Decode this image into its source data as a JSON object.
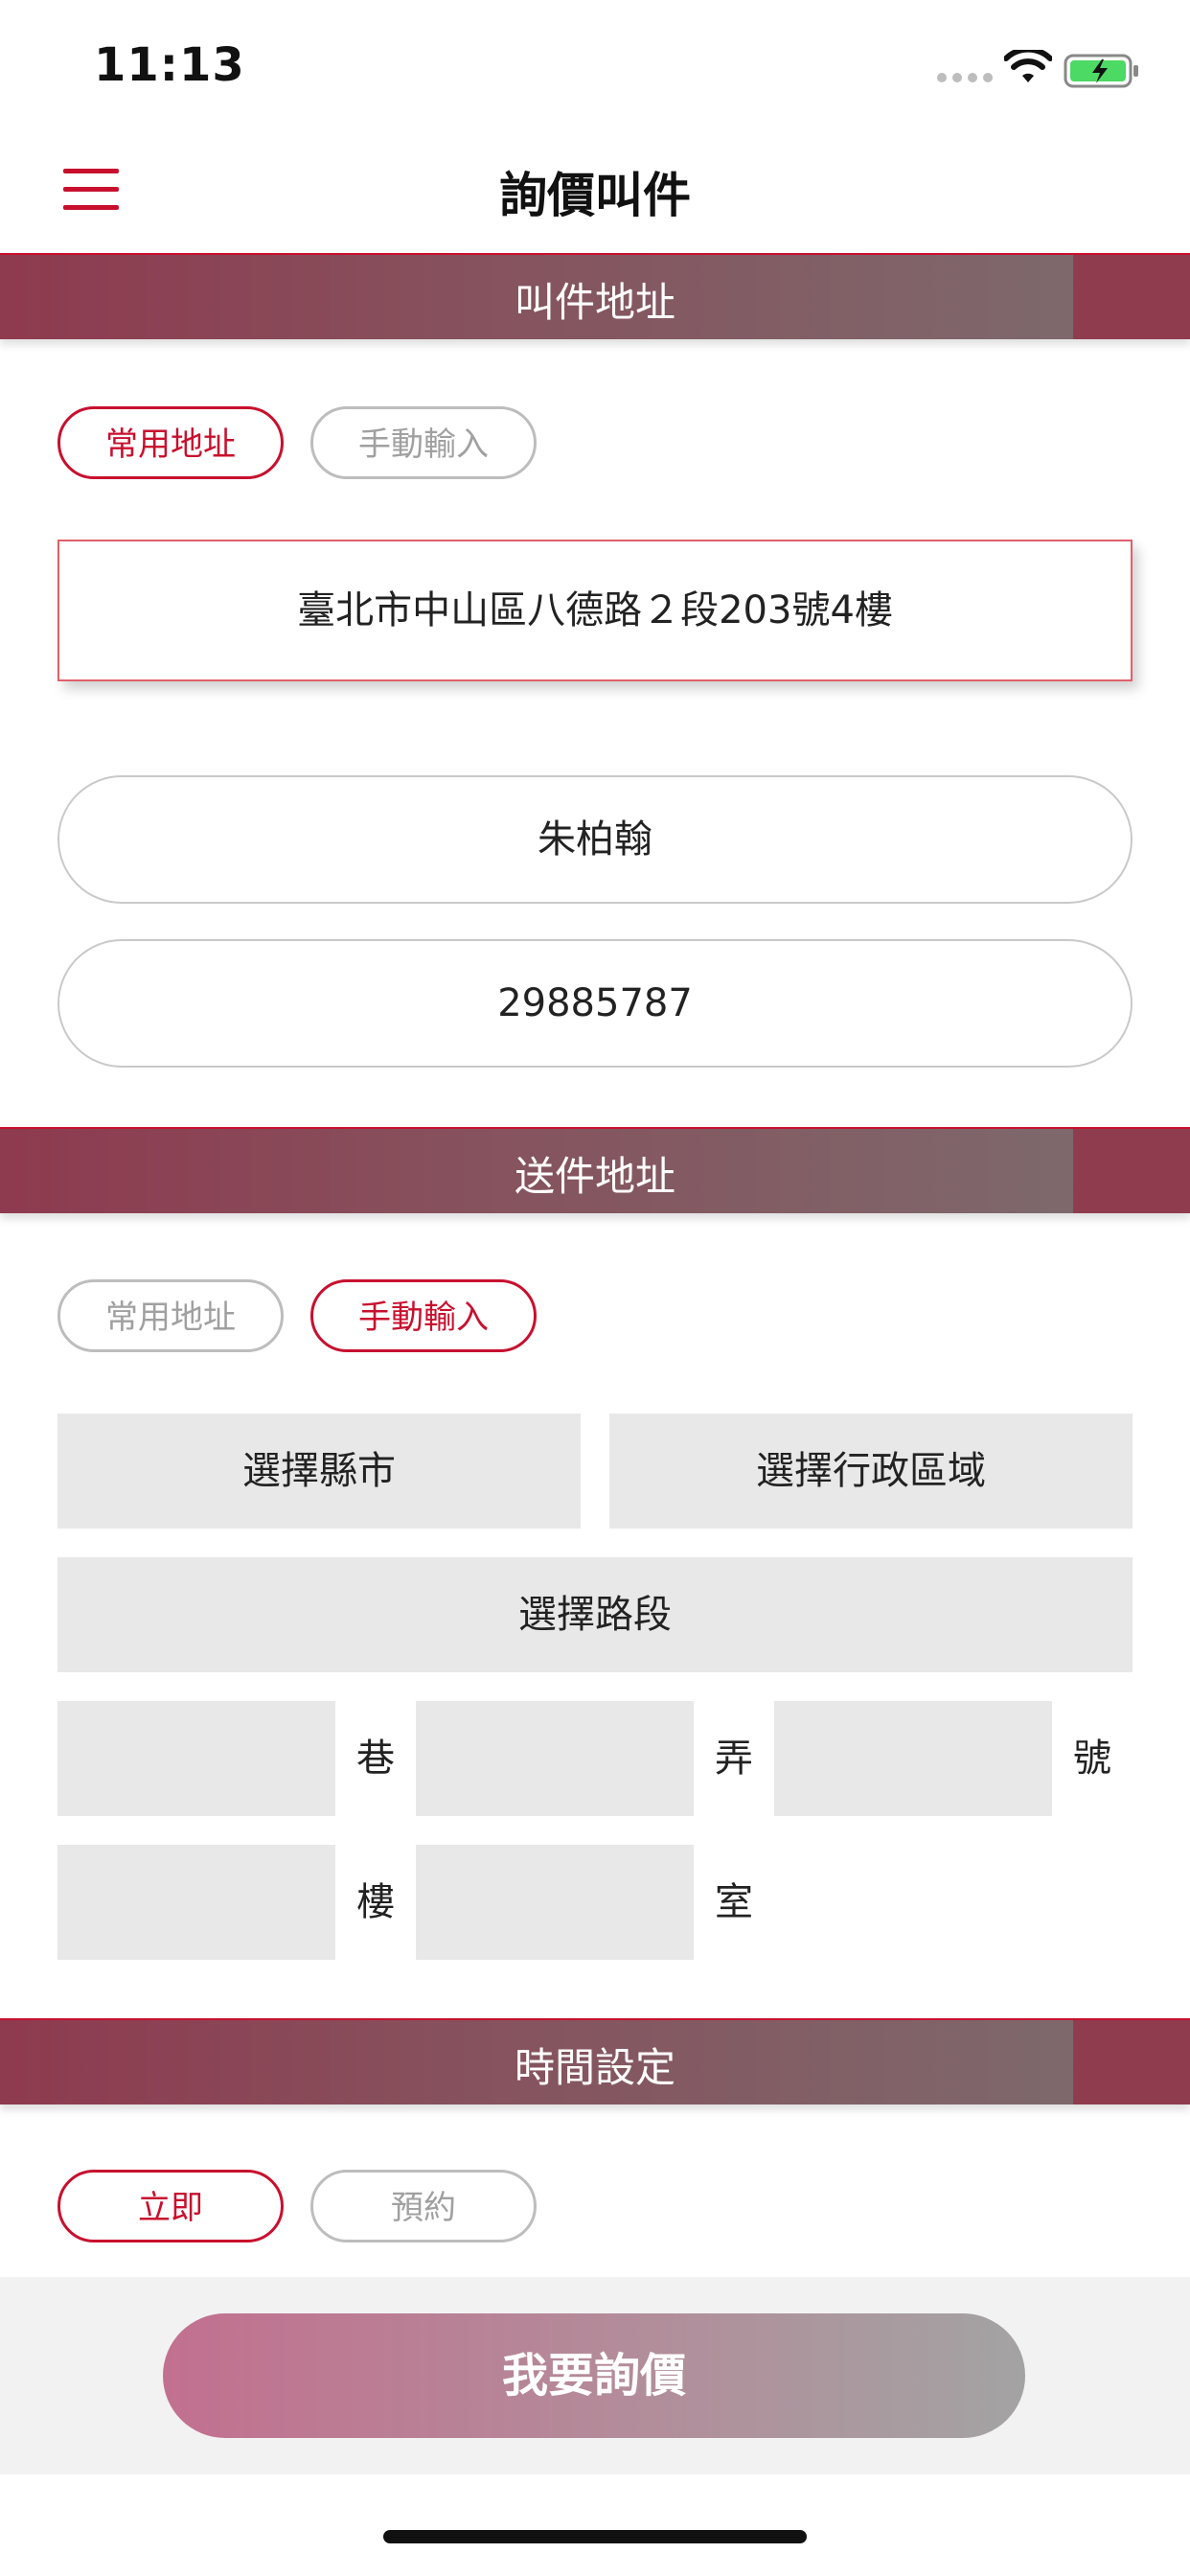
{
  "status": {
    "time": "11:13"
  },
  "header": {
    "title": "詢價叫件"
  },
  "pickup": {
    "section_title": "叫件地址",
    "tabs": [
      {
        "label": "常用地址",
        "active": true
      },
      {
        "label": "手動輸入",
        "active": false
      }
    ],
    "selected_address": "臺北市中山區八德路２段203號4樓",
    "name": "朱柏翰",
    "phone": "29885787"
  },
  "delivery": {
    "section_title": "送件地址",
    "tabs": [
      {
        "label": "常用地址",
        "active": false
      },
      {
        "label": "手動輸入",
        "active": true
      }
    ],
    "city_select": "選擇縣市",
    "district_select": "選擇行政區域",
    "road_select": "選擇路段",
    "lane_input": "",
    "lane_suffix": "巷",
    "alley_input": "",
    "alley_suffix": "弄",
    "number_input": "",
    "number_suffix": "號",
    "floor_input": "",
    "floor_suffix": "樓",
    "room_input": "",
    "room_suffix": "室"
  },
  "time_setting": {
    "section_title": "時間設定",
    "tabs": [
      {
        "label": "立即",
        "active": true
      },
      {
        "label": "預約",
        "active": false
      }
    ]
  },
  "footer": {
    "submit_label": "我要詢價"
  },
  "icons": {
    "menu": "hamburger-menu-icon",
    "wifi": "wifi-icon",
    "battery": "battery-charging-icon",
    "signal": "signal-dots-icon"
  },
  "colors": {
    "accent": "#c8102e",
    "section_bar_start": "#8e3a4f",
    "section_bar_end": "#7c6d6f",
    "inactive": "#a0a0a0",
    "field_bg": "#e8e8e8"
  }
}
